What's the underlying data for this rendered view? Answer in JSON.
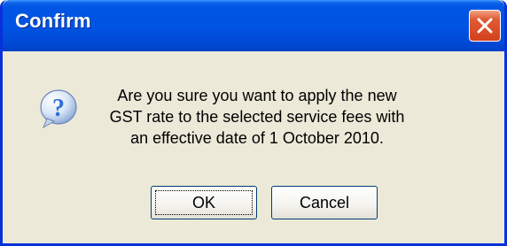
{
  "window": {
    "title": "Confirm",
    "close_label": "close"
  },
  "dialog": {
    "icon": "question-icon",
    "icon_glyph": "?",
    "message": "Are you sure you want to apply the new GST rate to the selected service fees with an effective date of 1 October 2010."
  },
  "buttons": {
    "ok_label": "OK",
    "cancel_label": "Cancel"
  },
  "colors": {
    "titlebar": "#0054e3",
    "window_body": "#ece9d8",
    "close_button": "#d4401c",
    "icon_blue": "#2f6fd6"
  }
}
